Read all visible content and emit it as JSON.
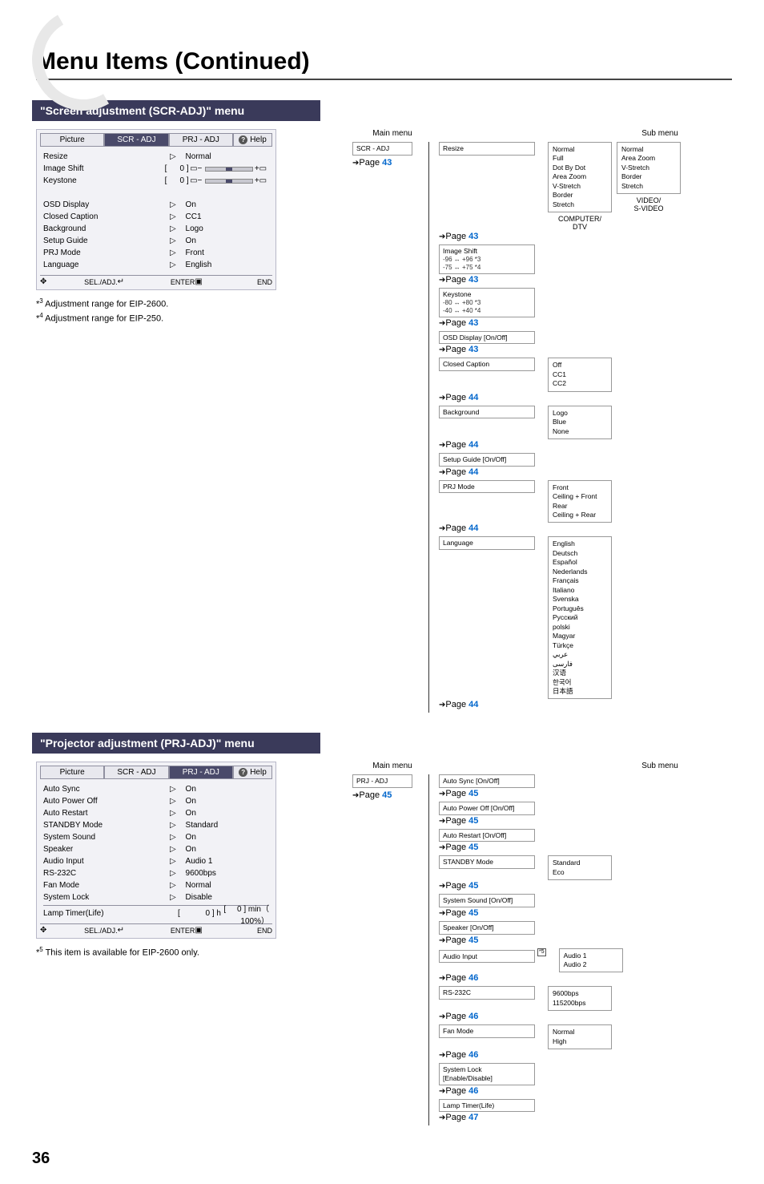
{
  "page_title": "Menu Items (Continued)",
  "page_number": "36",
  "section1": {
    "header": "\"Screen adjustment (SCR-ADJ)\" menu",
    "tabs": [
      "Picture",
      "SCR - ADJ",
      "PRJ - ADJ",
      "Help"
    ],
    "rows": [
      {
        "label": "Resize",
        "value": "Normal",
        "arrow": true
      },
      {
        "label": "Image Shift",
        "slider": true,
        "num": "0"
      },
      {
        "label": "Keystone",
        "slider": true,
        "num": "0"
      },
      {
        "label": "",
        "value": ""
      },
      {
        "label": "OSD Display",
        "value": "On",
        "arrow": true
      },
      {
        "label": "Closed Caption",
        "value": "CC1",
        "arrow": true
      },
      {
        "label": "Background",
        "value": "Logo",
        "arrow": true
      },
      {
        "label": "Setup Guide",
        "value": "On",
        "arrow": true
      },
      {
        "label": "PRJ Mode",
        "value": "Front",
        "arrow": true
      },
      {
        "label": "Language",
        "value": "English",
        "arrow": true
      }
    ],
    "footer": [
      "SEL./ADJ.",
      "ENTER",
      "END"
    ],
    "footnotes": [
      {
        "sup": "*3",
        "text": " Adjustment range for EIP-2600."
      },
      {
        "sup": "*4",
        "text": " Adjustment range for EIP-250."
      }
    ],
    "tree": {
      "main_h": "Main menu",
      "sub_h": "Sub menu",
      "main": {
        "label": "SCR - ADJ",
        "page": "43"
      },
      "items": [
        {
          "label": "Resize",
          "page": "43",
          "sub": [
            {
              "lines": [
                "Normal",
                "Full",
                "Dot By Dot",
                "Area Zoom",
                "V-Stretch",
                "Border",
                "Stretch"
              ],
              "caption": "COMPUTER/\nDTV"
            },
            {
              "lines": [
                "Normal",
                "Area Zoom",
                "V-Stretch",
                "Border",
                "Stretch"
              ],
              "caption": "VIDEO/\nS-VIDEO"
            }
          ]
        },
        {
          "label": "Image Shift",
          "notes": [
            "-96 ↔ +96 *3",
            "-75 ↔ +75 *4"
          ],
          "page": "43"
        },
        {
          "label": "Keystone",
          "notes": [
            "-80 ↔ +80 *3",
            "-40 ↔ +40 *4"
          ],
          "page": "43"
        },
        {
          "label": "OSD Display [On/Off]",
          "page": "43"
        },
        {
          "label": "Closed Caption",
          "page": "44",
          "sub": [
            {
              "lines": [
                "Off",
                "CC1",
                "CC2"
              ]
            }
          ]
        },
        {
          "label": "Background",
          "page": "44",
          "sub": [
            {
              "lines": [
                "Logo",
                "Blue",
                "None"
              ]
            }
          ]
        },
        {
          "label": "Setup Guide [On/Off]",
          "page": "44"
        },
        {
          "label": "PRJ Mode",
          "page": "44",
          "sub": [
            {
              "lines": [
                "Front",
                "Ceiling + Front",
                "Rear",
                "Ceiling + Rear"
              ]
            }
          ]
        },
        {
          "label": "Language",
          "page": "44",
          "sub": [
            {
              "lines": [
                "English",
                "Deutsch",
                "Español",
                "Nederlands",
                "Français",
                "Italiano",
                "Svenska",
                "Português",
                "Русский",
                "polski",
                "Magyar",
                "Türkçe",
                "عربي",
                "فارسى",
                "汉语",
                "한국어",
                "日本語"
              ]
            }
          ]
        }
      ]
    }
  },
  "section2": {
    "header": "\"Projector adjustment (PRJ-ADJ)\" menu",
    "tabs": [
      "Picture",
      "SCR - ADJ",
      "PRJ - ADJ",
      "Help"
    ],
    "rows": [
      {
        "label": "Auto Sync",
        "value": "On",
        "arrow": true
      },
      {
        "label": "Auto Power Off",
        "value": "On",
        "arrow": true
      },
      {
        "label": "Auto Restart",
        "value": "On",
        "arrow": true
      },
      {
        "label": "STANDBY Mode",
        "value": "Standard",
        "arrow": true
      },
      {
        "label": "System Sound",
        "value": "On",
        "arrow": true
      },
      {
        "label": "Speaker",
        "value": "On",
        "arrow": true
      },
      {
        "label": "Audio Input",
        "value": "Audio 1",
        "arrow": true
      },
      {
        "label": "RS-232C",
        "value": "9600bps",
        "arrow": true
      },
      {
        "label": "Fan Mode",
        "value": "Normal",
        "arrow": true
      },
      {
        "label": "System Lock",
        "value": "Disable",
        "arrow": true
      }
    ],
    "lamp_row": {
      "label": "Lamp Timer(Life)",
      "h": "0",
      "h_u": "h",
      "m": "0",
      "m_u": "min",
      "pct": "100%"
    },
    "footer": [
      "SEL./ADJ.",
      "ENTER",
      "END"
    ],
    "footnotes": [
      {
        "sup": "*5",
        "text": " This item is available for EIP-2600 only."
      }
    ],
    "tree": {
      "main_h": "Main menu",
      "sub_h": "Sub menu",
      "main": {
        "label": "PRJ - ADJ",
        "page": "45"
      },
      "items": [
        {
          "label": "Auto Sync [On/Off]",
          "page": "45"
        },
        {
          "label": "Auto Power Off [On/Off]",
          "page": "45"
        },
        {
          "label": "Auto Restart [On/Off]",
          "page": "45"
        },
        {
          "label": "STANDBY Mode",
          "page": "45",
          "sub": [
            {
              "lines": [
                "Standard",
                "Eco"
              ]
            }
          ]
        },
        {
          "label": "System Sound [On/Off]",
          "page": "45"
        },
        {
          "label": "Speaker [On/Off]",
          "page": "45"
        },
        {
          "label": "Audio Input",
          "page": "46",
          "star": "*5",
          "sub": [
            {
              "lines": [
                "Audio 1",
                "Audio 2"
              ]
            }
          ]
        },
        {
          "label": "RS-232C",
          "page": "46",
          "sub": [
            {
              "lines": [
                "9600bps",
                "115200bps"
              ]
            }
          ]
        },
        {
          "label": "Fan Mode",
          "page": "46",
          "sub": [
            {
              "lines": [
                "Normal",
                "High"
              ]
            }
          ]
        },
        {
          "label": "System Lock\n[Enable/Disable]",
          "page": "46"
        },
        {
          "label": "Lamp Timer(Life)",
          "page": "47"
        }
      ]
    }
  }
}
